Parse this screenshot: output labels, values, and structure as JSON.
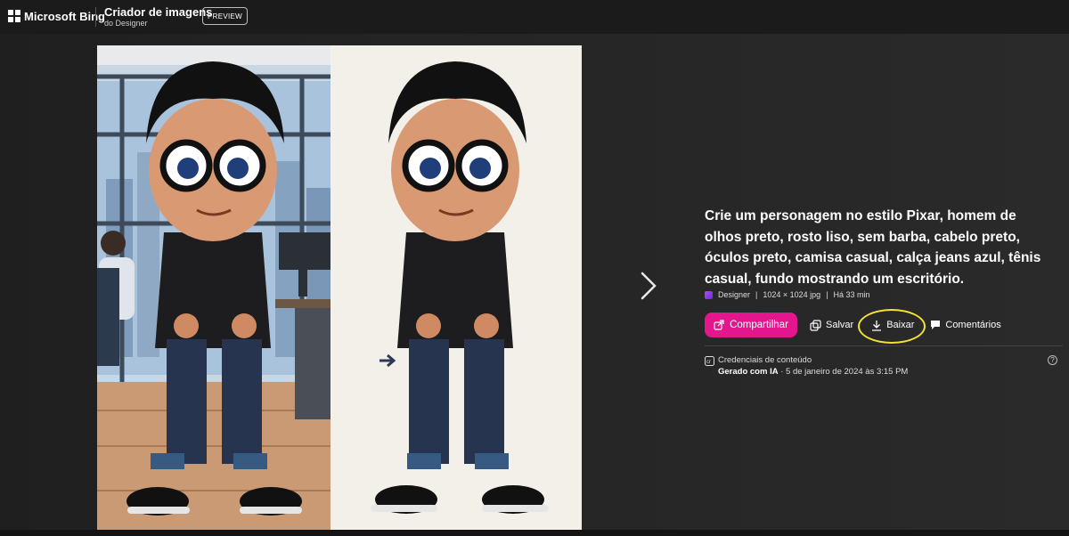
{
  "header": {
    "brand": "Microsoft Bing",
    "app_title": "Criador de imagens",
    "app_subtitle": "do Designer",
    "badge": "PREVIEW"
  },
  "prompt": "Crie um personagem no estilo Pixar, homem de olhos preto, rosto liso, sem barba, cabelo preto, óculos preto, camisa casual, calça jeans azul, tênis casual, fundo mostrando um escritório.",
  "meta": {
    "source": "Designer",
    "dimensions": "1024 × 1024 jpg",
    "age": "Há 33 min"
  },
  "actions": {
    "share": "Compartilhar",
    "save": "Salvar",
    "download": "Baixar",
    "comments": "Comentários"
  },
  "credentials": {
    "title": "Credenciais de conteúdo",
    "generated": "Gerado com IA",
    "date": "· 5 de janeiro de 2024 às 3:15 PM"
  },
  "colors": {
    "accent": "#e3168d",
    "highlight": "#f3e233",
    "background": "#222222"
  },
  "icons": [
    "microsoft-logo-icon",
    "chevron-right-icon",
    "share-icon",
    "save-collection-icon",
    "download-icon",
    "comment-icon",
    "content-credentials-icon",
    "help-icon"
  ]
}
